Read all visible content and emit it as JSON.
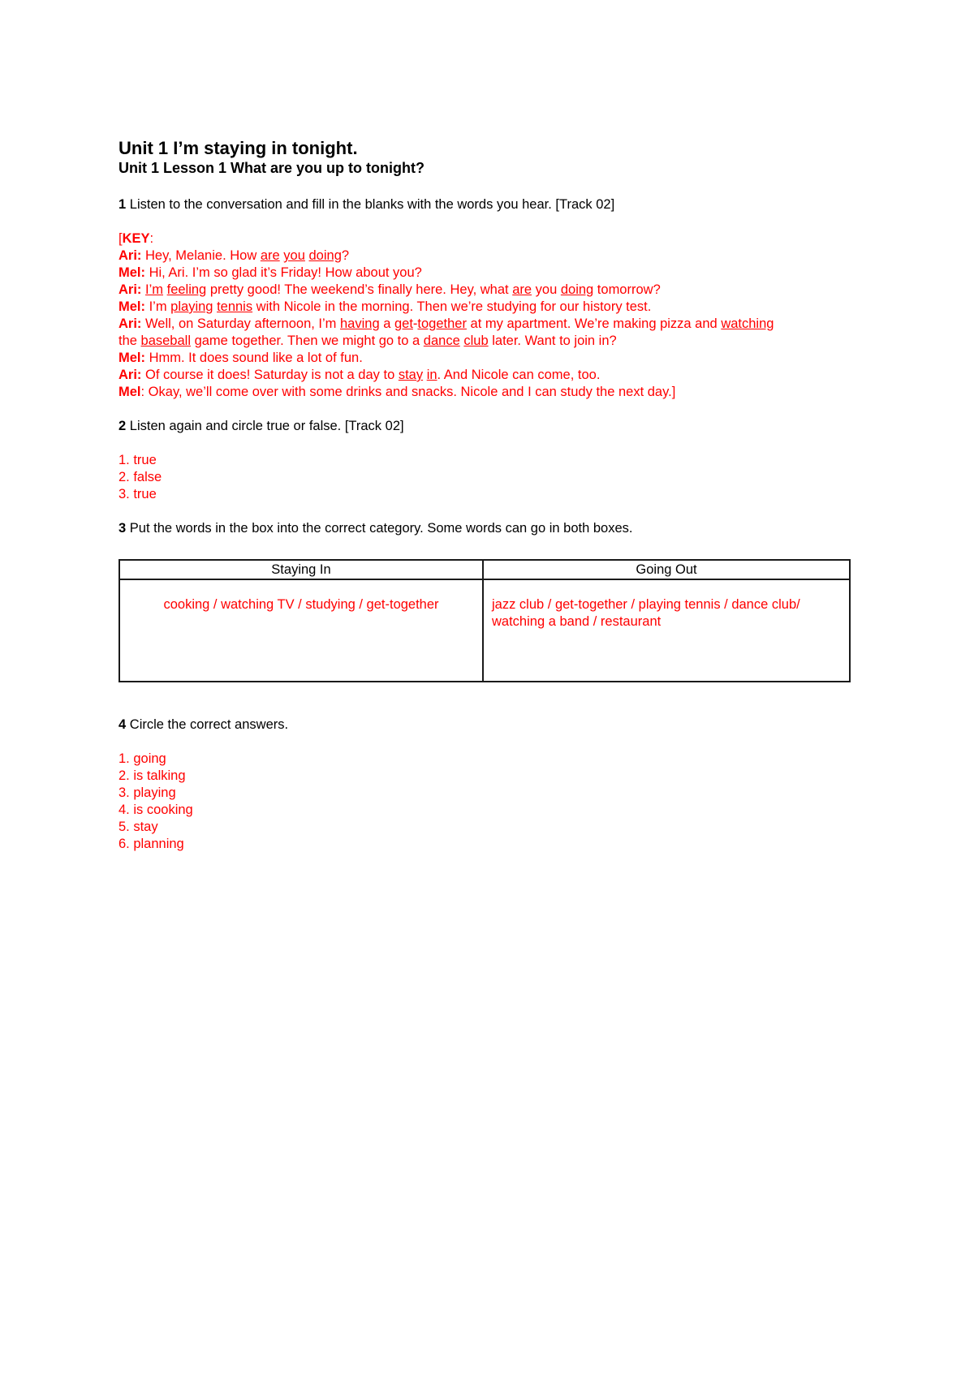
{
  "title": "Unit 1 I’m staying in tonight.",
  "subtitle": {
    "bold": "Unit 1 Lesson 1 What are you up to tonight",
    "tail": "?"
  },
  "colors": {
    "answer": "#ff0000",
    "text": "#000000"
  },
  "exercise1": {
    "num": "1",
    "instruction": " Listen to the conversation and fill in the blanks with the words you hear. [Track 02]",
    "key_open": "[",
    "key_label": "KEY",
    "key_colon": ":",
    "lines": [
      [
        {
          "t": "Ari:",
          "b": true
        },
        {
          "t": " Hey, Melanie. How "
        },
        {
          "t": "are",
          "u": true
        },
        {
          "t": " "
        },
        {
          "t": "you",
          "u": true
        },
        {
          "t": " "
        },
        {
          "t": "doing",
          "u": true
        },
        {
          "t": "?"
        }
      ],
      [
        {
          "t": "Mel:",
          "b": true
        },
        {
          "t": " Hi, Ari. I’m so glad it’s Friday! How about you?"
        }
      ],
      [
        {
          "t": "Ari:",
          "b": true
        },
        {
          "t": " "
        },
        {
          "t": "I’m",
          "u": true
        },
        {
          "t": " "
        },
        {
          "t": "feeling",
          "u": true
        },
        {
          "t": " pretty good! The weekend’s finally here. Hey, what "
        },
        {
          "t": "are",
          "u": true
        },
        {
          "t": " you "
        },
        {
          "t": "doing",
          "u": true
        },
        {
          "t": " tomorrow?"
        }
      ],
      [
        {
          "t": "Mel:",
          "b": true
        },
        {
          "t": " I’m "
        },
        {
          "t": "playing",
          "u": true
        },
        {
          "t": " "
        },
        {
          "t": "tennis",
          "u": true
        },
        {
          "t": " with Nicole in the morning. Then we’re studying for our history test."
        }
      ],
      [
        {
          "t": "Ari:",
          "b": true
        },
        {
          "t": " Well, on Saturday afternoon, I’m "
        },
        {
          "t": "having",
          "u": true
        },
        {
          "t": " a "
        },
        {
          "t": "get",
          "u": true
        },
        {
          "t": "-"
        },
        {
          "t": "together",
          "u": true
        },
        {
          "t": " at my apartment. We’re making pizza and "
        },
        {
          "t": "watching",
          "u": true
        }
      ],
      [
        {
          "t": "the "
        },
        {
          "t": "baseball",
          "u": true
        },
        {
          "t": " game together. Then we might go to a "
        },
        {
          "t": "dance",
          "u": true
        },
        {
          "t": " "
        },
        {
          "t": "club",
          "u": true
        },
        {
          "t": " later. Want to join in?"
        }
      ],
      [
        {
          "t": "Mel:",
          "b": true
        },
        {
          "t": " Hmm. It does sound like a lot of fun."
        }
      ],
      [
        {
          "t": "Ari:",
          "b": true
        },
        {
          "t": " Of course it does! Saturday is not a day to "
        },
        {
          "t": "stay",
          "u": true
        },
        {
          "t": " "
        },
        {
          "t": "in",
          "u": true
        },
        {
          "t": ". And Nicole can come, too."
        }
      ],
      [
        {
          "t": "Mel",
          "b": true
        },
        {
          "t": ": Okay, we’ll come over with some drinks and snacks. Nicole and I can study the next day.]"
        }
      ]
    ]
  },
  "exercise2": {
    "num": "2",
    "instruction": " Listen again and circle true or false. [Track 02]",
    "answers": [
      "1. true",
      "2. false",
      "3. true"
    ]
  },
  "exercise3": {
    "num": "3",
    "instruction": " Put the words in the box into the correct category. Some words can go in both boxes.",
    "table": {
      "headers": [
        "Staying In",
        "Going Out"
      ],
      "cells": [
        "cooking / watching TV / studying / get-together",
        "jazz club / get-together / playing tennis / dance club/ watching a band / restaurant"
      ]
    }
  },
  "exercise4": {
    "num": "4",
    "instruction": " Circle the correct answers.",
    "answers": [
      "1. going",
      "2. is talking",
      "3. playing",
      "4. is cooking",
      "5. stay",
      "6. planning"
    ]
  }
}
